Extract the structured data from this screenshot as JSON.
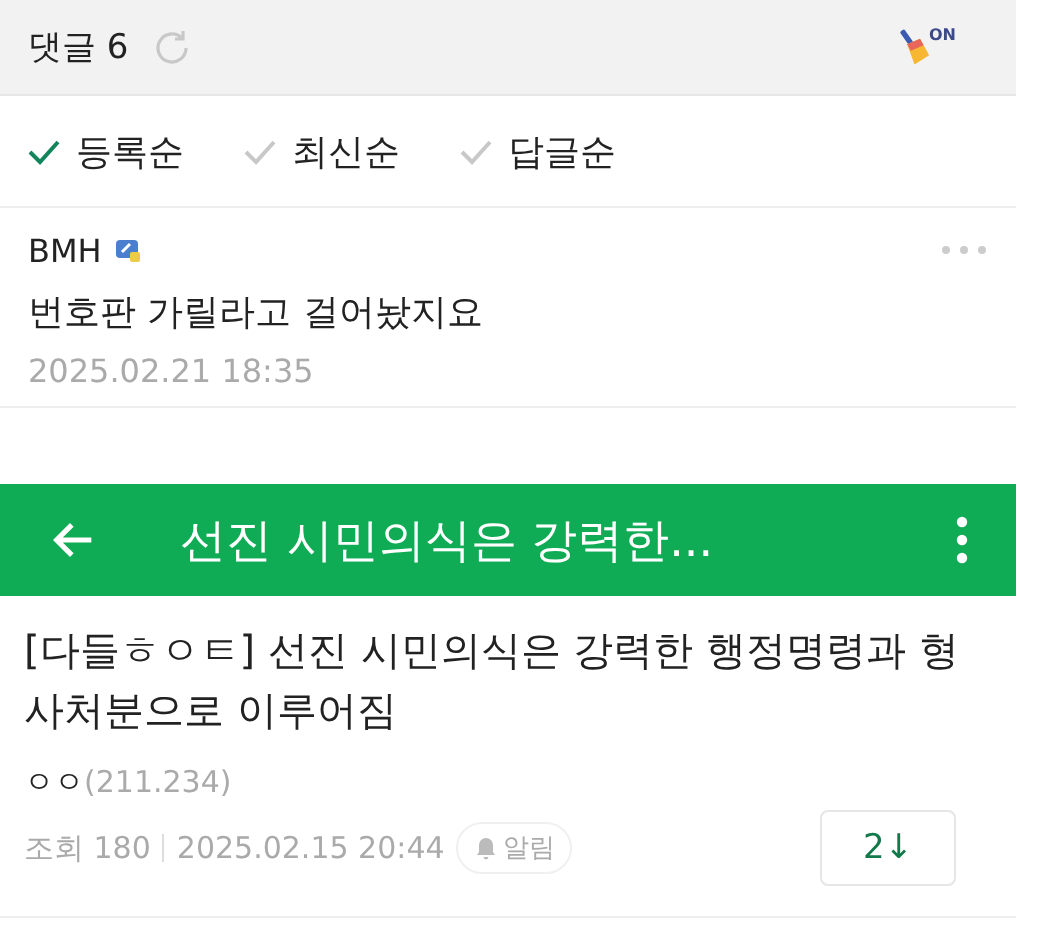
{
  "comments_header": {
    "title": "댓글 6",
    "filter_badge": "ON"
  },
  "sort_options": [
    {
      "label": "등록순",
      "selected": true
    },
    {
      "label": "최신순",
      "selected": false
    },
    {
      "label": "답글순",
      "selected": false
    }
  ],
  "comments": [
    {
      "author": "BMH",
      "text": "번호판 가릴라고 걸어놨지요",
      "date": "2025.02.21 18:35"
    }
  ],
  "app_bar": {
    "title": "선진 시민의식은 강력한..."
  },
  "post": {
    "title": "[다들ㅎㅇㅌ] 선진 시민의식은 강력한 행정명령과 형사처분으로 이루어짐",
    "author": "ㅇㅇ",
    "ip": "(211.234)",
    "views_label": "조회 180",
    "date": "2025.02.15 20:44",
    "alert_label": "알림",
    "comment_count": "2↓"
  }
}
